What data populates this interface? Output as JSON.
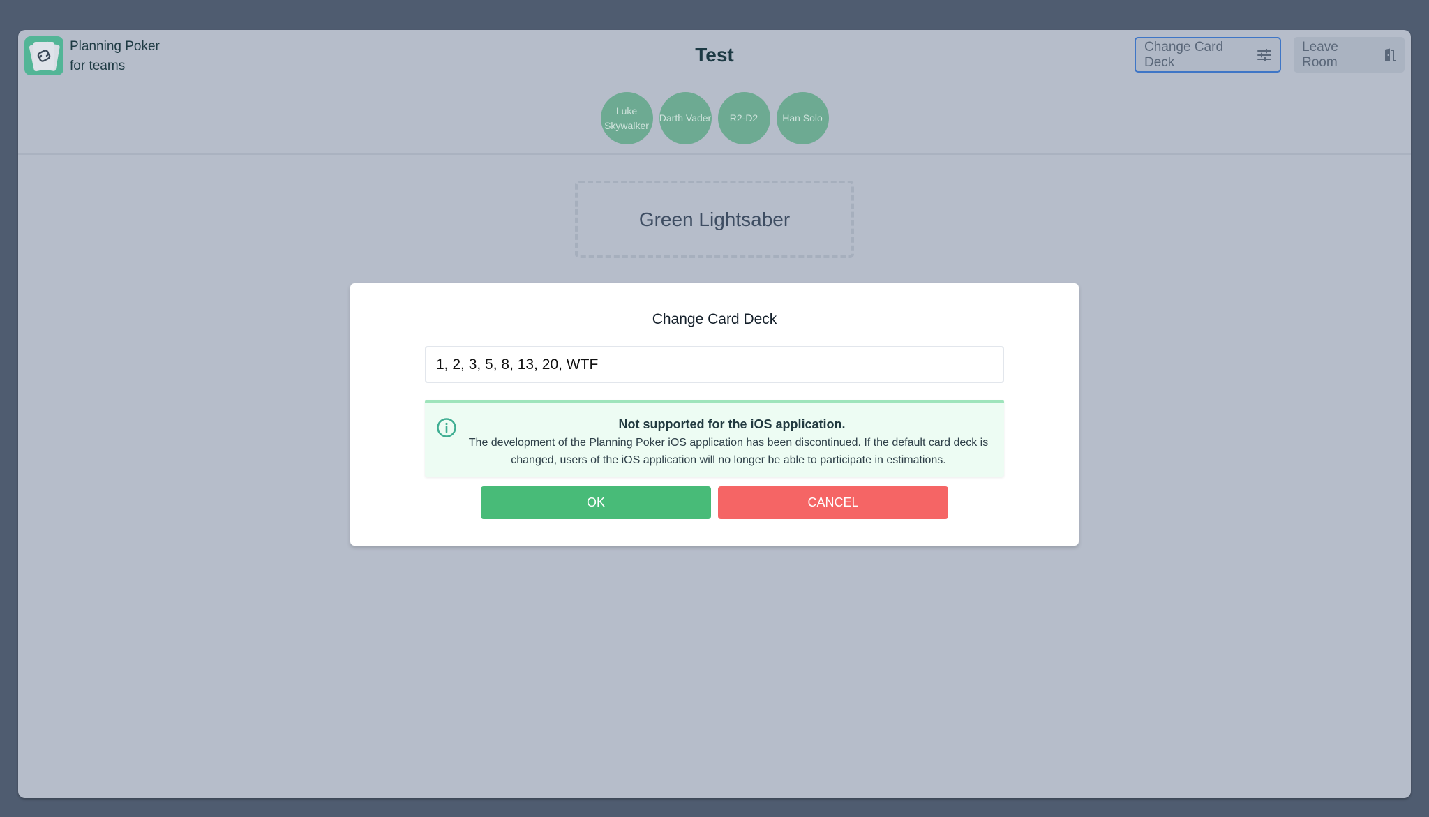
{
  "brand": {
    "line1": "Planning Poker",
    "line2": "for teams",
    "icon": "cards-link-logo"
  },
  "room": {
    "title": "Test"
  },
  "players": [
    {
      "name": "Luke Skywalker"
    },
    {
      "name": "Darth Vader"
    },
    {
      "name": "R2-D2"
    },
    {
      "name": "Han Solo"
    }
  ],
  "toolbar": {
    "change_deck_label": "Change Card Deck",
    "change_deck_icon": "sliders-icon",
    "leave_room_label": "Leave Room",
    "leave_room_icon": "door-exit-icon"
  },
  "selected_card": {
    "label": "Green Lightsaber"
  },
  "modal": {
    "title": "Change Card Deck",
    "deck_input_value": "1, 2, 3, 5, 8, 13, 20, WTF",
    "alert": {
      "icon": "info-icon",
      "title": "Not supported for the iOS application.",
      "body": "The development of the Planning Poker iOS application has been discontinued. If the default card deck is changed, users of the iOS application will no longer be able to participate in estimations."
    },
    "ok_label": "OK",
    "cancel_label": "CANCEL"
  },
  "colors": {
    "accent_green": "#48bb78",
    "danger_red": "#f56565",
    "avatar_green": "#6daa92",
    "focus_blue": "#3f76c6",
    "alert_bg": "#edfcf3",
    "alert_border": "#9ee4bb"
  }
}
